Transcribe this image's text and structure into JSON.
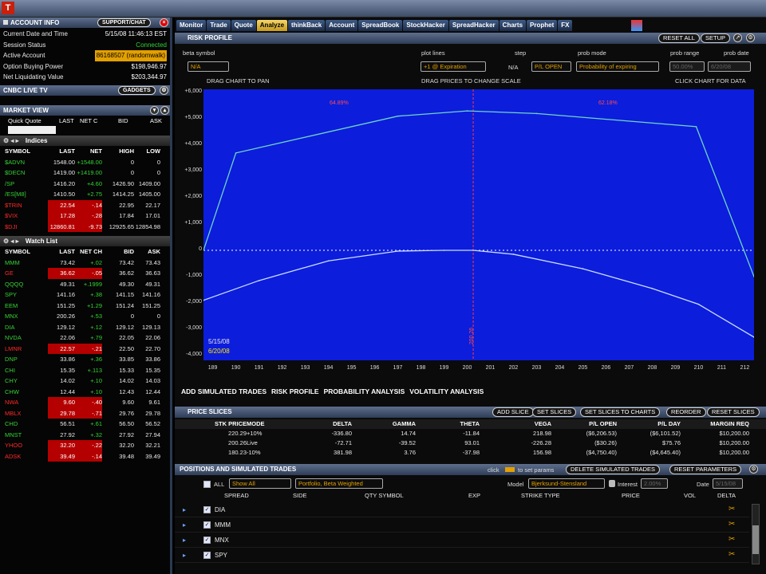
{
  "account_info": {
    "title": "ACCOUNT INFO",
    "support_label": "SUPPORT/CHAT",
    "rows": [
      {
        "label": "Current Date and Time",
        "value": "5/15/08 11:46:13 EST"
      },
      {
        "label": "Session Status",
        "value": "Connected"
      },
      {
        "label": "Active Account",
        "value": "86168507 (randomwalk)"
      },
      {
        "label": "Option Buying Power",
        "value": "$198,946.97"
      },
      {
        "label": "Net Liquidating Value",
        "value": "$203,344.97"
      }
    ]
  },
  "cnbc": {
    "title": "CNBC LIVE TV",
    "gadgets_label": "GADGETS"
  },
  "market_view": {
    "title": "MARKET VIEW",
    "quick_quote_label": "Quick Quote",
    "cols": [
      "LAST",
      "NET C",
      "BID",
      "ASK"
    ]
  },
  "indices": {
    "title": "Indices",
    "headers": [
      "SYMBOL",
      "LAST",
      "NET",
      "HIGH",
      "LOW"
    ],
    "rows": [
      [
        "$ADVN",
        "1548.00",
        "+1548.00",
        "0",
        "0",
        "g"
      ],
      [
        "$DECN",
        "1419.00",
        "+1419.00",
        "0",
        "0",
        "g"
      ],
      [
        "/SP",
        "1416.20",
        "+4.60",
        "1426.90",
        "1409.00",
        "g"
      ],
      [
        "/ES[M8]",
        "1410.50",
        "+2.75",
        "1414.25",
        "1405.00",
        "g"
      ],
      [
        "$TRIN",
        "22.54",
        "-.14",
        "22.95",
        "22.17",
        "r"
      ],
      [
        "$VIX",
        "17.28",
        "-.28",
        "17.84",
        "17.01",
        "r"
      ],
      [
        "$DJI",
        "12860.81",
        "-9.73",
        "12925.65",
        "12854.98",
        "r"
      ]
    ]
  },
  "watchlist": {
    "title": "Watch List",
    "headers": [
      "SYMBOL",
      "LAST",
      "NET CH",
      "BID",
      "ASK"
    ],
    "rows": [
      [
        "MMM",
        "73.42",
        "+.02",
        "73.42",
        "73.43",
        "g"
      ],
      [
        "GE",
        "36.62",
        "-.05",
        "36.62",
        "36.63",
        "r"
      ],
      [
        "QQQQ",
        "49.31",
        "+.1999",
        "49.30",
        "49.31",
        "g"
      ],
      [
        "SPY",
        "141.16",
        "+.38",
        "141.15",
        "141.16",
        "g"
      ],
      [
        "EEM",
        "151.25",
        "+1.29",
        "151.24",
        "151.25",
        "g"
      ],
      [
        "MNX",
        "200.26",
        "+.53",
        "0",
        "0",
        "g"
      ],
      [
        "DIA",
        "129.12",
        "+.12",
        "129.12",
        "129.13",
        "g"
      ],
      [
        "NVDA",
        "22.06",
        "+.79",
        "22.05",
        "22.06",
        "g"
      ],
      [
        "LMNR",
        "22.57",
        "-.21",
        "22.50",
        "22.70",
        "r"
      ],
      [
        "DNP",
        "33.86",
        "+.36",
        "33.85",
        "33.86",
        "g"
      ],
      [
        "CHI",
        "15.35",
        "+.113",
        "15.33",
        "15.35",
        "g"
      ],
      [
        "CHY",
        "14.02",
        "+.10",
        "14.02",
        "14.03",
        "g"
      ],
      [
        "CHW",
        "12.44",
        "+.10",
        "12.43",
        "12.44",
        "g"
      ],
      [
        "NWA",
        "9.60",
        "-.40",
        "9.60",
        "9.61",
        "r"
      ],
      [
        "MBLX",
        "29.78",
        "-.71",
        "29.76",
        "29.78",
        "r"
      ],
      [
        "CHD",
        "56.51",
        "+.61",
        "56.50",
        "56.52",
        "g"
      ],
      [
        "MNST",
        "27.92",
        "+.32",
        "27.92",
        "27.94",
        "g"
      ],
      [
        "YHOO",
        "32.20",
        "-.22",
        "32.20",
        "32.21",
        "r"
      ],
      [
        "ADSK",
        "39.49",
        "-.14",
        "39.48",
        "39.49",
        "r"
      ]
    ]
  },
  "tabs": [
    "Monitor",
    "Trade",
    "Quote",
    "Analyze",
    "thinkBack",
    "Account",
    "SpreadBook",
    "StockHacker",
    "SpreadHacker",
    "Charts",
    "Prophet",
    "FX"
  ],
  "active_tab": "Analyze",
  "risk_profile": {
    "title": "RISK PROFILE",
    "reset_all": "RESET ALL",
    "setup": "SETUP",
    "beta_symbol_label": "beta symbol",
    "beta_symbol_value": "N/A",
    "plot_lines_label": "plot lines",
    "plot_lines_value": "+1 @ Expiration",
    "step_label": "step",
    "step_value": "N/A",
    "pl_value": "P/L OPEN",
    "prob_mode_label": "prob mode",
    "prob_mode_value": "Probability of expiring",
    "prob_range_label": "prob range",
    "prob_range_value": "50.00%",
    "prob_date_label": "prob date",
    "prob_date_value": "6/20/08",
    "drag_chart": "DRAG CHART TO PAN",
    "drag_prices": "DRAG PRICES TO CHANGE SCALE",
    "click_chart": "CLICK CHART FOR DATA",
    "date1": "5/15/08",
    "date2": "6/20/08",
    "marker1": "64.89%",
    "marker2": "62.18%",
    "marker_center": "200.26"
  },
  "chart_data": {
    "type": "line",
    "x_ticks": [
      189,
      190,
      191,
      192,
      193,
      194,
      195,
      196,
      197,
      198,
      199,
      200,
      201,
      202,
      203,
      204,
      205,
      206,
      207,
      208,
      209,
      210,
      211,
      212
    ],
    "y_ticks": [
      "-4,000",
      "-3,000",
      "-2,000",
      "-1,000",
      "0",
      "+1,000",
      "+2,000",
      "+3,000",
      "+4,000",
      "+5,000",
      "+6,000"
    ],
    "xlim": [
      188.6,
      212.4
    ],
    "ylim": [
      -4000,
      6000
    ],
    "series": [
      {
        "color": "#6fd6c8",
        "x": [
          188.6,
          190.0,
          197.0,
          200.0,
          203.0,
          209.9,
          212.4
        ],
        "y": [
          0,
          3700,
          5100,
          5300,
          5200,
          4700,
          -1000
        ]
      },
      {
        "color": "#c9dcff",
        "x": [
          188.6,
          191,
          194,
          197,
          199,
          200.26,
          202,
          205,
          208,
          210,
          212.4
        ],
        "y": [
          -1900,
          -1150,
          -400,
          -30,
          0,
          0,
          -150,
          -700,
          -1450,
          -2050,
          -3300
        ]
      }
    ]
  },
  "subtabs": [
    "ADD SIMULATED TRADES",
    "RISK PROFILE",
    "PROBABILITY ANALYSIS",
    "VOLATILITY ANALYSIS"
  ],
  "price_slices": {
    "title": "PRICE SLICES",
    "buttons": [
      "ADD SLICE",
      "SET SLICES",
      "SET SLICES TO CHARTS",
      "REORDER",
      "RESET SLICES"
    ],
    "headers": [
      "STK PRICE",
      "MODE",
      "DELTA",
      "GAMMA",
      "THETA",
      "VEGA",
      "P/L OPEN",
      "P/L DAY",
      "MARGIN REQ"
    ],
    "rows": [
      [
        "220.29",
        "+10%",
        "-336.80",
        "14.74",
        "-11.84",
        "218.98",
        "($6,206.53)",
        "($6,101.52)",
        "$10,200.00"
      ],
      [
        "200.26",
        "Live",
        "-72.71",
        "-39.52",
        "93.01",
        "-226.28",
        "($30.26)",
        "$75.76",
        "$10,200.00"
      ],
      [
        "180.23",
        "-10%",
        "381.98",
        "3.76",
        "-37.98",
        "156.98",
        "($4,750.40)",
        "($4,645.40)",
        "$10,200.00"
      ]
    ]
  },
  "positions": {
    "title": "POSITIONS AND SIMULATED TRADES",
    "click_hint": "click",
    "set_params_hint": "to set params",
    "delete_btn": "DELETE SIMULATED TRADES",
    "reset_params_btn": "RESET PARAMETERS",
    "all_label": "ALL",
    "show_value": "Show All",
    "group_value": "Portfolio, Beta Weighted",
    "model_label": "Model",
    "model_value": "Bjerksund-Stensland",
    "interest_label": "Interest",
    "interest_value": "2.00%",
    "date_label": "Date",
    "date_value": "5/15/08",
    "headers": [
      "SPREAD",
      "SIDE",
      "QTY SYMBOL",
      "EXP",
      "STRIKE TYPE",
      "PRICE",
      "VOL",
      "DELTA"
    ],
    "symbols": [
      "DIA",
      "MMM",
      "MNX",
      "SPY"
    ]
  }
}
